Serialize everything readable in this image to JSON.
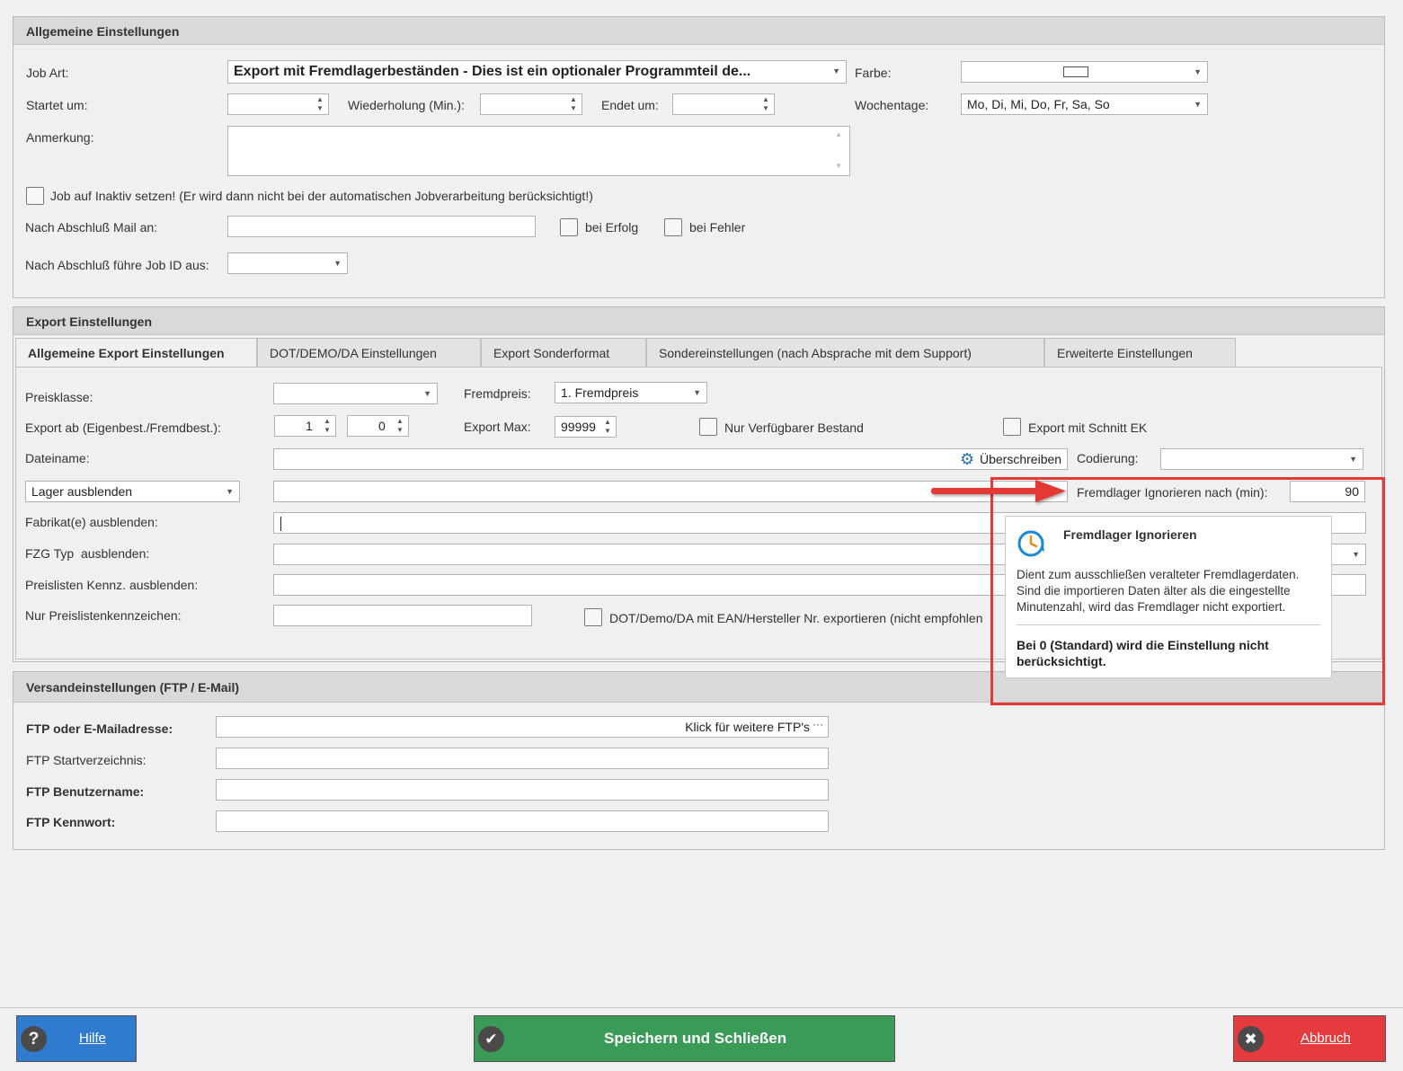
{
  "general": {
    "title": "Allgemeine Einstellungen",
    "job_art_label": "Job Art:",
    "job_art_value": "Export mit Fremdlagerbeständen - Dies ist ein optionaler Programmteil de...",
    "farbe_label": "Farbe:",
    "startet_label": "Startet um:",
    "wiederholung_label": "Wiederholung (Min.):",
    "endet_label": "Endet um:",
    "wochentage_label": "Wochentage:",
    "wochentage_value": "Mo, Di, Mi, Do, Fr, Sa, So",
    "anmerkung_label": "Anmerkung:",
    "inaktiv_label": "Job auf Inaktiv setzen! (Er wird dann nicht bei der automatischen Jobverarbeitung berücksichtigt!)",
    "mail_label": "Nach Abschluß Mail an:",
    "bei_erfolg": "bei Erfolg",
    "bei_fehler": "bei Fehler",
    "job_id_label": "Nach Abschluß führe Job ID aus:"
  },
  "export": {
    "title": "Export Einstellungen",
    "tabs": [
      {
        "label": "Allgemeine Export Einstellungen",
        "active": true
      },
      {
        "label": "DOT/DEMO/DA Einstellungen"
      },
      {
        "label": "Export Sonderformat"
      },
      {
        "label": "Sondereinstellungen (nach Absprache mit dem Support)"
      },
      {
        "label": "Erweiterte Einstellungen"
      }
    ],
    "preisklasse_label": "Preisklasse:",
    "fremdpreis_label": "Fremdpreis:",
    "fremdpreis_value": "1. Fremdpreis",
    "export_ab_label": "Export ab (Eigenbest./Fremdbest.):",
    "export_ab_eigen": "1",
    "export_ab_fremd": "0",
    "export_max_label": "Export Max:",
    "export_max_value": "99999",
    "nur_verfuegbar_label": "Nur Verfügbarer Bestand",
    "schnitt_ek_label": "Export mit Schnitt EK",
    "dateiname_label": "Dateiname:",
    "ueberschreiben_label": "Überschreiben",
    "codierung_label": "Codierung:",
    "lager_ausblenden_value": "Lager ausblenden",
    "fremdlager_ignorieren_label": "Fremdlager Ignorieren nach (min):",
    "fremdlager_ignorieren_value": "90",
    "fabrikat_label": "Fabrikat(e) ausblenden:",
    "fzg_label": "FZG Typ  ausblenden:",
    "preislisten_label": "Preislisten Kennz. ausblenden:",
    "nur_preislisten_label": "Nur Preislistenkennzeichen:",
    "dot_demo_label": "DOT/Demo/DA mit EAN/Hersteller Nr. exportieren (nicht empfohlen"
  },
  "tooltip": {
    "title": "Fremdlager Ignorieren",
    "body_line1": "Dient zum ausschließen veralteter Fremdlagerdaten.",
    "body_line2": "Sind die importieren Daten älter als die eingestellte",
    "body_line3": "Minutenzahl, wird das Fremdlager nicht exportiert.",
    "note_line1": "Bei 0 (Standard) wird die Einstellung nicht",
    "note_line2": "berücksichtigt."
  },
  "versand": {
    "title": "Versandeinstellungen (FTP / E-Mail)",
    "ftp_label": "FTP oder E-Mailadresse:",
    "ftp_value": "Klick für weitere FTP's",
    "start_label": "FTP Startverzeichnis:",
    "user_label": "FTP Benutzername:",
    "pass_label": "FTP Kennwort:"
  },
  "buttons": {
    "hilfe": "Hilfe",
    "speichern": "Speichern und Schließen",
    "abbruch": "Abbruch"
  },
  "colors": {
    "hilfe_bg": "#2e7bd0",
    "speichern_bg": "#3a9a57",
    "abbruch_bg": "#e53a3e",
    "highlight": "#e53935",
    "tooltip_icon": "#1a8ad4"
  },
  "icons": {
    "help": "question-icon",
    "save": "check-icon",
    "cancel": "close-icon",
    "gear": "gear-icon",
    "clock": "clock-icon"
  }
}
